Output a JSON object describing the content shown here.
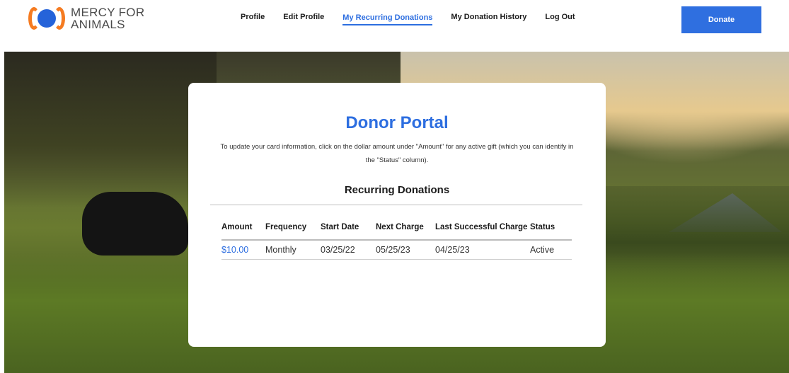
{
  "brand": {
    "logo_line1": "MERCY FOR",
    "logo_line2": "ANIMALS",
    "accent_color": "#2d6ee0",
    "logo_orange": "#f57b21",
    "logo_blue": "#2563d9"
  },
  "nav": {
    "items": [
      {
        "label": "Profile",
        "active": false
      },
      {
        "label": "Edit Profile",
        "active": false
      },
      {
        "label": "My Recurring Donations",
        "active": true
      },
      {
        "label": "My Donation History",
        "active": false
      },
      {
        "label": "Log Out",
        "active": false
      }
    ],
    "donate_label": "Donate"
  },
  "card": {
    "title": "Donor Portal",
    "description": "To update your card information, click on the dollar amount under \"Amount\" for any active gift (which you can identify in the \"Status\" column).",
    "section_title": "Recurring Donations"
  },
  "table": {
    "headers": [
      "Amount",
      "Frequency",
      "Start Date",
      "Next Charge",
      "Last Successful Charge",
      "Status"
    ],
    "rows": [
      {
        "amount": "$10.00",
        "frequency": "Monthly",
        "start_date": "03/25/22",
        "next_charge": "05/25/23",
        "last_successful_charge": "04/25/23",
        "status": "Active"
      }
    ]
  }
}
